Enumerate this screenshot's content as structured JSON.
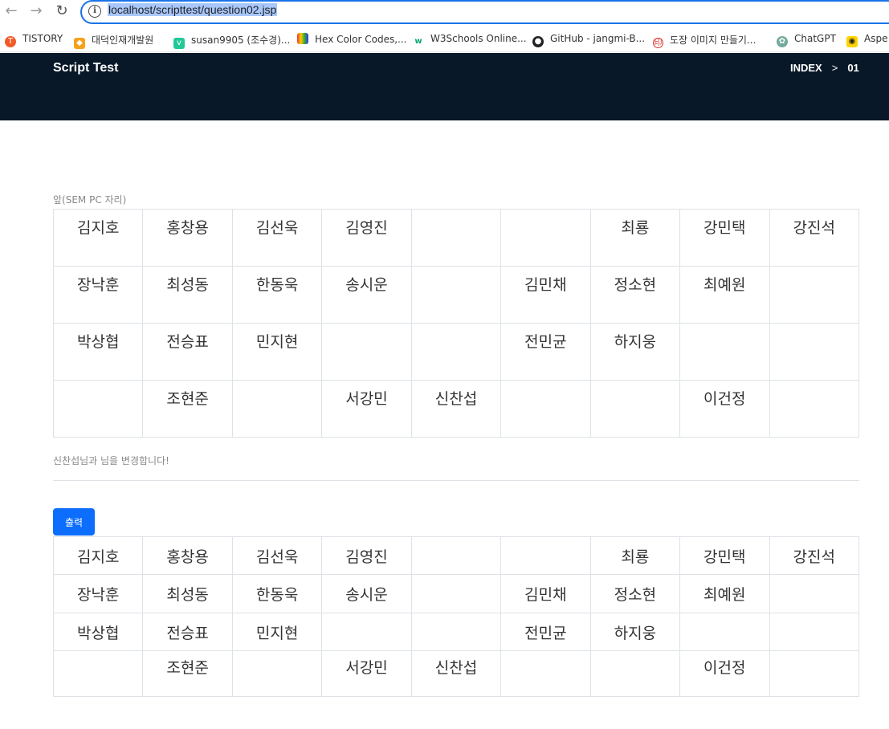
{
  "browser": {
    "url": "localhost/scripttest/question02.jsp",
    "bookmarks": [
      "TISTORY",
      "대덕인재개발원",
      "susan9905 (조수경)...",
      "Hex Color Codes,...",
      "W3Schools Online...",
      "GitHub - jangmi-B...",
      "도장 이미지 만들기...",
      "ChatGPT",
      "Aspe"
    ]
  },
  "header": {
    "brand": "Script Test",
    "crumb_index": "INDEX",
    "crumb_sep": ">",
    "crumb_page": "01"
  },
  "seat_caption": "앞(SEM PC 자리)",
  "grid1": [
    [
      "김지호",
      "홍창용",
      "김선욱",
      "김영진",
      "",
      "",
      "최룡",
      "강민택",
      "강진석"
    ],
    [
      "장낙훈",
      "최성동",
      "한동욱",
      "송시운",
      "",
      "김민채",
      "정소현",
      "최예원",
      ""
    ],
    [
      "박상협",
      "전승표",
      "민지현",
      "",
      "",
      "전민균",
      "하지웅",
      "",
      ""
    ],
    [
      "",
      "조현준",
      "",
      "서강민",
      "신찬섭",
      "",
      "",
      "이건정",
      ""
    ]
  ],
  "message": "신찬섭님과 님을 변경합니다!",
  "output_button": "출력",
  "grid2": [
    [
      "김지호",
      "홍창용",
      "김선욱",
      "김영진",
      "",
      "",
      "최룡",
      "강민택",
      "강진석"
    ],
    [
      "장낙훈",
      "최성동",
      "한동욱",
      "송시운",
      "",
      "김민채",
      "정소현",
      "최예원",
      ""
    ],
    [
      "박상협",
      "전승표",
      "민지현",
      "",
      "",
      "전민균",
      "하지웅",
      "",
      ""
    ],
    [
      "",
      "조현준",
      "",
      "서강민",
      "신찬섭",
      "",
      "",
      "이건정",
      ""
    ]
  ],
  "highlight_color": "#4a4af4"
}
